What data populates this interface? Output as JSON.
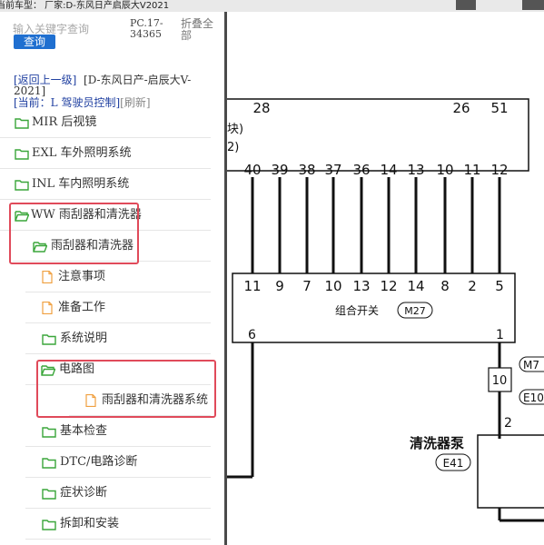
{
  "topbar": {
    "label": "当前车型： 厂家:D-东风日产启辰大V2021"
  },
  "search": {
    "placeholder": "输入关键字查询",
    "button_label": "查询"
  },
  "pc_code": "PC.17-34365",
  "fold_all": "折叠全部",
  "nav": {
    "back_label": "[返回上一级]",
    "model_label": "[D-东风日产-启辰大V-2021]",
    "current_label": "[当前：L 驾驶员控制]",
    "refresh_label": "[刷新]"
  },
  "tree": {
    "mir": "MIR 后视镜",
    "exl": "EXL 车外照明系统",
    "inl": "INL 车内照明系统",
    "ww": "WW 雨刮器和清洗器",
    "wiper": "雨刮器和清洗器",
    "notes": "注意事项",
    "prep": "准备工作",
    "sysdesc": "系统说明",
    "circuit": "电路图",
    "circuit_child": "雨刮器和清洗器系统",
    "basic": "基本检查",
    "dtc": "DTC/电路诊断",
    "symptom": "症状诊断",
    "removal": "拆卸和安装"
  },
  "colors": {
    "accent": "#1f6fd0",
    "highlight": "#e04a5a",
    "folder": "#3aa63a",
    "doc": "#f0a040"
  },
  "diagram": {
    "top_pins": [
      "28",
      "26",
      "51"
    ],
    "block_text": [
      "块)",
      "2)"
    ],
    "upper_pins": [
      "40",
      "39",
      "38",
      "37",
      "36",
      "14",
      "13",
      "10",
      "11",
      "12"
    ],
    "switch_pins": [
      "11",
      "9",
      "7",
      "10",
      "13",
      "12",
      "14",
      "8",
      "2",
      "5"
    ],
    "switch_name": "组合开关",
    "switch_code": "M27",
    "switch_bottom_left": "6",
    "switch_bottom_right": "1",
    "side_pin": "10",
    "side_code_1": "M7",
    "side_code_2": "E10",
    "pump_pin": "2",
    "pump_name": "清洗器泵",
    "pump_code": "E41"
  }
}
